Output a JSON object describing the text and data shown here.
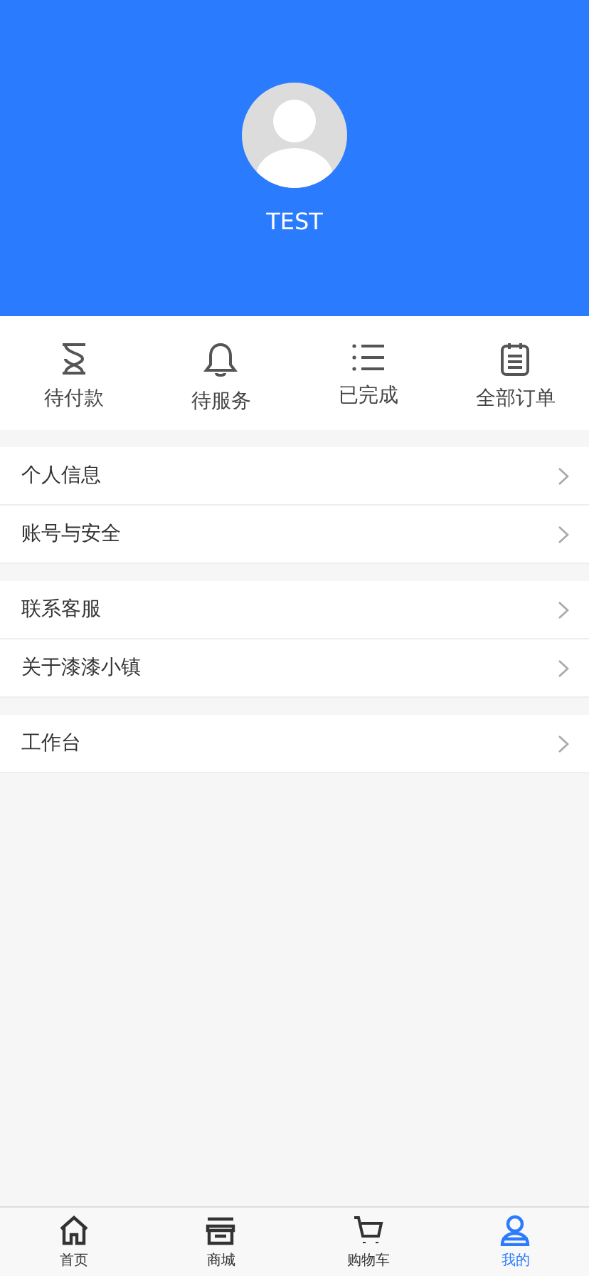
{
  "profile": {
    "name": "TEST"
  },
  "orders": [
    {
      "kind": "hourglass",
      "label": "待付款"
    },
    {
      "kind": "bell",
      "label": "待服务"
    },
    {
      "kind": "list",
      "label": "已完成"
    },
    {
      "kind": "clipboard",
      "label": "全部订单"
    }
  ],
  "menu_groups": [
    [
      {
        "label": "个人信息"
      },
      {
        "label": "账号与安全"
      }
    ],
    [
      {
        "label": "联系客服"
      },
      {
        "label": "关于漆漆小镇"
      }
    ],
    [
      {
        "label": "工作台"
      }
    ]
  ],
  "tab_bar": [
    {
      "kind": "home",
      "label": "首页",
      "selected": false
    },
    {
      "kind": "store",
      "label": "商城",
      "selected": false
    },
    {
      "kind": "cart",
      "label": "购物车",
      "selected": false
    },
    {
      "kind": "user",
      "label": "我的",
      "selected": true
    }
  ]
}
